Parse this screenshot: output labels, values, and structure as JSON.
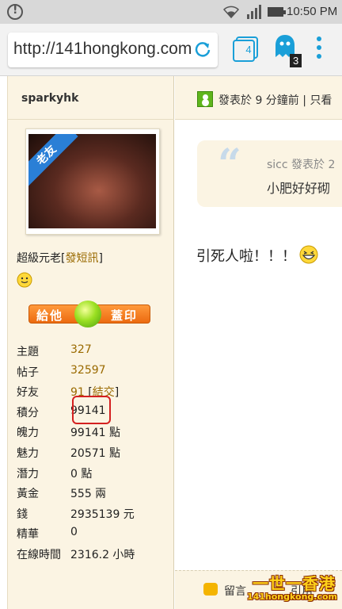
{
  "status_bar": {
    "time": "10:50 PM",
    "icons": [
      "alert-icon",
      "wifi-icon",
      "signal-icon",
      "battery-icon"
    ]
  },
  "browser": {
    "url": "http://141hongkong.com",
    "tab_count": "4",
    "ghost_badge": "3",
    "accent_color": "#1a9fd8"
  },
  "profile": {
    "username": "sparkyhk",
    "avatar_label": "老友",
    "rank": "超級元老",
    "pm_link": "發短訊",
    "stamp_button": {
      "left": "給他",
      "right": "蓋印"
    },
    "stats": [
      {
        "label": "主題",
        "value": "327"
      },
      {
        "label": "帖子",
        "value": "32597"
      },
      {
        "label": "好友",
        "value": "91",
        "extra": "結交"
      },
      {
        "label": "積分",
        "value": "99141"
      },
      {
        "label": "魄力",
        "value": "99141 點"
      },
      {
        "label": "魅力",
        "value": "20571 點"
      },
      {
        "label": "潛力",
        "value": "0 點"
      },
      {
        "label": "黃金",
        "value": "555 兩"
      },
      {
        "label": "錢",
        "value": "2935139 元"
      },
      {
        "label": "精華",
        "value": "0"
      },
      {
        "label": "在線時間",
        "value": "2316.2 小時"
      }
    ]
  },
  "post": {
    "meta": "發表於 9 分鐘前",
    "meta_extra": "只看",
    "quote_author": "sicc 發表於 2",
    "quote_text": "小肥好好砌",
    "body": "引死人啦！！！",
    "footer": {
      "reply": "留言",
      "cite": "引用"
    }
  },
  "watermark": {
    "title": "一世一香港",
    "url": "141hongkong.com"
  }
}
